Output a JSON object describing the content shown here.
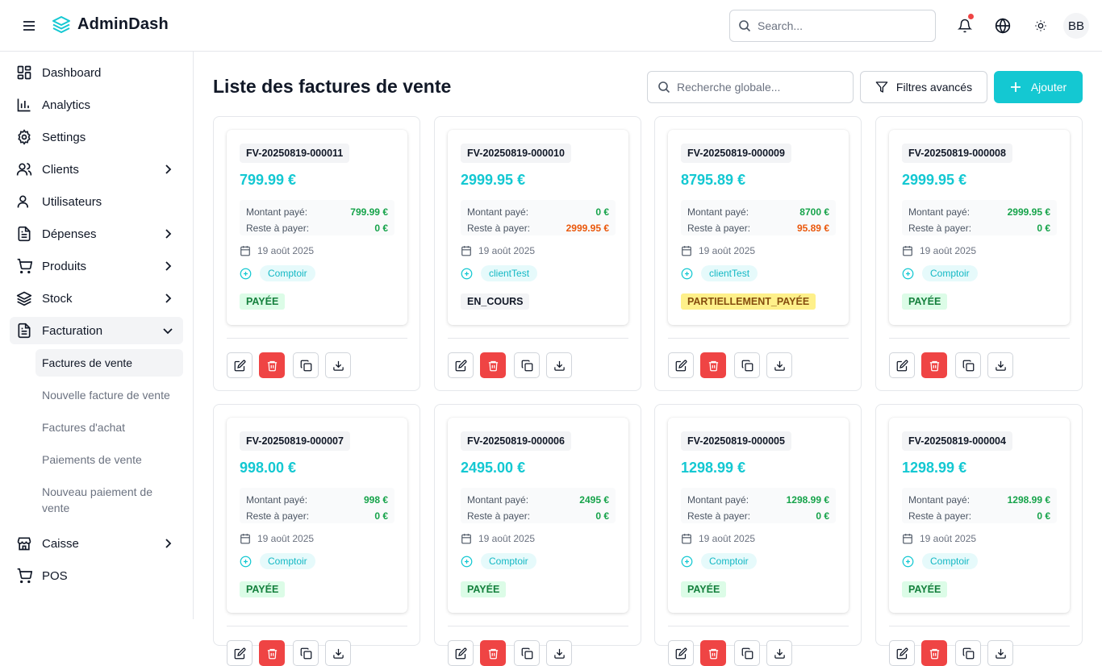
{
  "app": {
    "name": "AdminDash"
  },
  "header": {
    "search_placeholder": "Search...",
    "avatar_initials": "BB"
  },
  "sidebar": {
    "items": [
      {
        "label": "Dashboard",
        "icon": "dashboard-icon",
        "has_chevron": false
      },
      {
        "label": "Analytics",
        "icon": "bar-chart-icon",
        "has_chevron": false
      },
      {
        "label": "Settings",
        "icon": "gear-icon",
        "has_chevron": false
      },
      {
        "label": "Clients",
        "icon": "users-icon",
        "has_chevron": true
      },
      {
        "label": "Utilisateurs",
        "icon": "user-icon",
        "has_chevron": false
      },
      {
        "label": "Dépenses",
        "icon": "document-icon",
        "has_chevron": true
      },
      {
        "label": "Produits",
        "icon": "cart-icon",
        "has_chevron": true
      },
      {
        "label": "Stock",
        "icon": "layers-icon",
        "has_chevron": true
      },
      {
        "label": "Facturation",
        "icon": "document-icon",
        "has_chevron": true,
        "expanded": true
      },
      {
        "label": "Caisse",
        "icon": "store-icon",
        "has_chevron": true
      },
      {
        "label": "POS",
        "icon": "cart-icon",
        "has_chevron": false
      }
    ],
    "facturation_sub": [
      {
        "label": "Factures de vente",
        "active": true
      },
      {
        "label": "Nouvelle facture de vente"
      },
      {
        "label": "Factures d'achat"
      },
      {
        "label": "Paiements de vente"
      },
      {
        "label": "Nouveau paiement de vente"
      }
    ]
  },
  "main": {
    "title": "Liste des factures de vente",
    "search_placeholder": "Recherche globale...",
    "filter_label": "Filtres avancés",
    "add_label": "Ajouter"
  },
  "labels": {
    "paid": "Montant payé:",
    "remaining": "Reste à payer:"
  },
  "invoices": [
    {
      "number": "FV-20250819-000011",
      "amount": "799.99 €",
      "paid": "799.99 €",
      "remaining": "0 €",
      "date": "19 août 2025",
      "client": "Comptoir",
      "status": "PAYÉE",
      "status_kind": "paid"
    },
    {
      "number": "FV-20250819-000010",
      "amount": "2999.95 €",
      "paid": "0 €",
      "remaining": "2999.95 €",
      "date": "19 août 2025",
      "client": "clientTest",
      "status": "EN_COURS",
      "status_kind": "progress"
    },
    {
      "number": "FV-20250819-000009",
      "amount": "8795.89 €",
      "paid": "8700 €",
      "remaining": "95.89 €",
      "date": "19 août 2025",
      "client": "clientTest",
      "status": "PARTIELLEMENT_PAYÉE",
      "status_kind": "partial"
    },
    {
      "number": "FV-20250819-000008",
      "amount": "2999.95 €",
      "paid": "2999.95 €",
      "remaining": "0 €",
      "date": "19 août 2025",
      "client": "Comptoir",
      "status": "PAYÉE",
      "status_kind": "paid"
    },
    {
      "number": "FV-20250819-000007",
      "amount": "998.00 €",
      "paid": "998 €",
      "remaining": "0 €",
      "date": "19 août 2025",
      "client": "Comptoir",
      "status": "PAYÉE",
      "status_kind": "paid"
    },
    {
      "number": "FV-20250819-000006",
      "amount": "2495.00 €",
      "paid": "2495 €",
      "remaining": "0 €",
      "date": "19 août 2025",
      "client": "Comptoir",
      "status": "PAYÉE",
      "status_kind": "paid"
    },
    {
      "number": "FV-20250819-000005",
      "amount": "1298.99 €",
      "paid": "1298.99 €",
      "remaining": "0 €",
      "date": "19 août 2025",
      "client": "Comptoir",
      "status": "PAYÉE",
      "status_kind": "paid"
    },
    {
      "number": "FV-20250819-000004",
      "amount": "1298.99 €",
      "paid": "1298.99 €",
      "remaining": "0 €",
      "date": "19 août 2025",
      "client": "Comptoir",
      "status": "PAYÉE",
      "status_kind": "paid"
    }
  ],
  "colors": {
    "accent": "#14c8d2",
    "paid_green": "#16a34a",
    "due_orange": "#ea580c",
    "danger": "#ef4444",
    "status_paid_bg": "#dcfce7",
    "status_paid_fg": "#15803d",
    "status_progress_bg": "#f3f4f6",
    "status_progress_fg": "#111827",
    "status_partial_bg": "#fef08a",
    "status_partial_fg": "#854d0e"
  }
}
